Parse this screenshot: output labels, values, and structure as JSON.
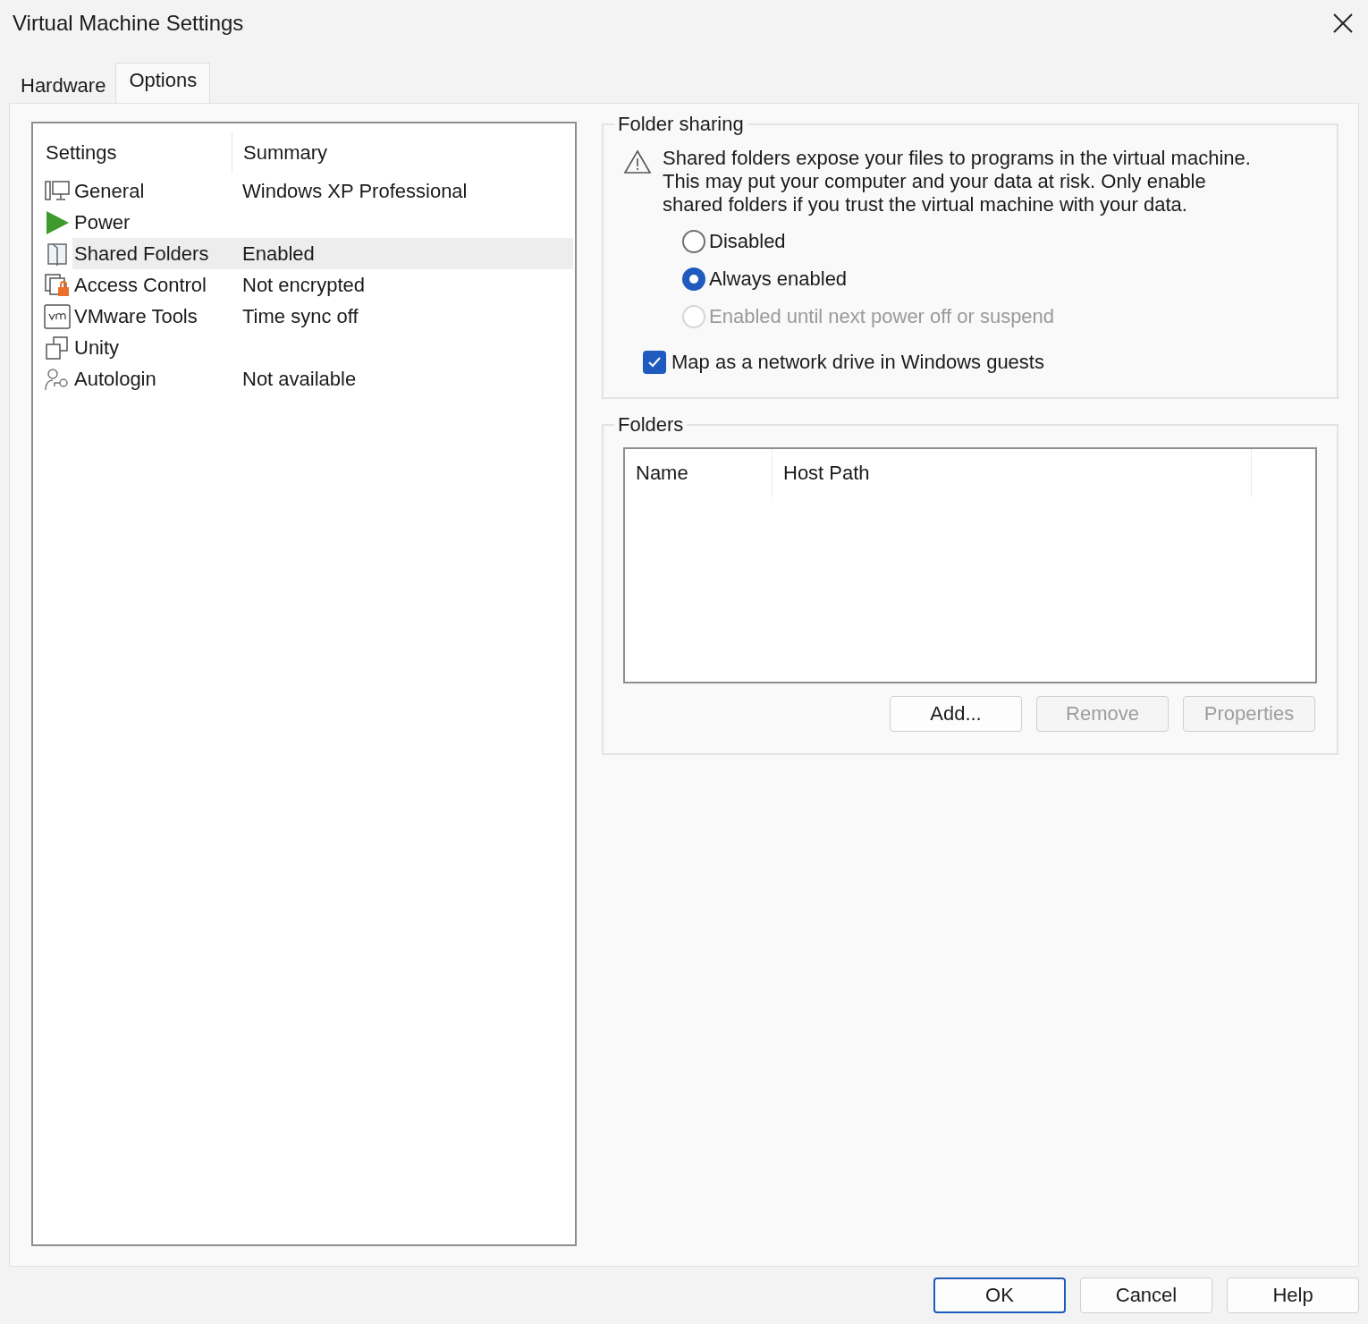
{
  "window": {
    "title": "Virtual Machine Settings"
  },
  "tabs": [
    {
      "label": "Hardware",
      "selected": false
    },
    {
      "label": "Options",
      "selected": true
    }
  ],
  "settings_list": {
    "columns": [
      "Settings",
      "Summary"
    ],
    "rows": [
      {
        "kind": "monitor",
        "name": "General",
        "summary": "Windows XP Professional",
        "selected": false
      },
      {
        "kind": "power",
        "name": "Power",
        "selected": false
      },
      {
        "kind": "folder",
        "name": "Shared Folders",
        "summary": "Enabled",
        "selected": true
      },
      {
        "kind": "lock",
        "name": "Access Control",
        "summary": "Not encrypted",
        "selected": false
      },
      {
        "kind": "vm",
        "name": "VMware Tools",
        "summary": "Time sync off",
        "selected": false
      },
      {
        "kind": "windows",
        "name": "Unity",
        "selected": false
      },
      {
        "kind": "user",
        "name": "Autologin",
        "summary": "Not available",
        "selected": false
      }
    ]
  },
  "folder_sharing": {
    "title": "Folder sharing",
    "warning": "Shared folders expose your files to programs in the virtual machine. This may put your computer and your data at risk. Only enable shared folders if you trust the virtual machine with your data.",
    "options": [
      {
        "label": "Disabled",
        "selected": false,
        "disabled": false
      },
      {
        "label": "Always enabled",
        "selected": true,
        "disabled": false
      },
      {
        "label": "Enabled until next power off or suspend",
        "selected": false,
        "disabled": true
      }
    ],
    "map_drive": {
      "label": "Map as a network drive in Windows guests",
      "checked": true
    }
  },
  "folders": {
    "title": "Folders",
    "columns": [
      "Name",
      "Host Path"
    ],
    "buttons": [
      {
        "label": "Add...",
        "disabled": false
      },
      {
        "label": "Remove",
        "disabled": true
      },
      {
        "label": "Properties",
        "disabled": true
      }
    ]
  },
  "footer_buttons": [
    {
      "label": "OK",
      "default": true
    },
    {
      "label": "Cancel",
      "default": false
    },
    {
      "label": "Help",
      "default": false
    }
  ]
}
